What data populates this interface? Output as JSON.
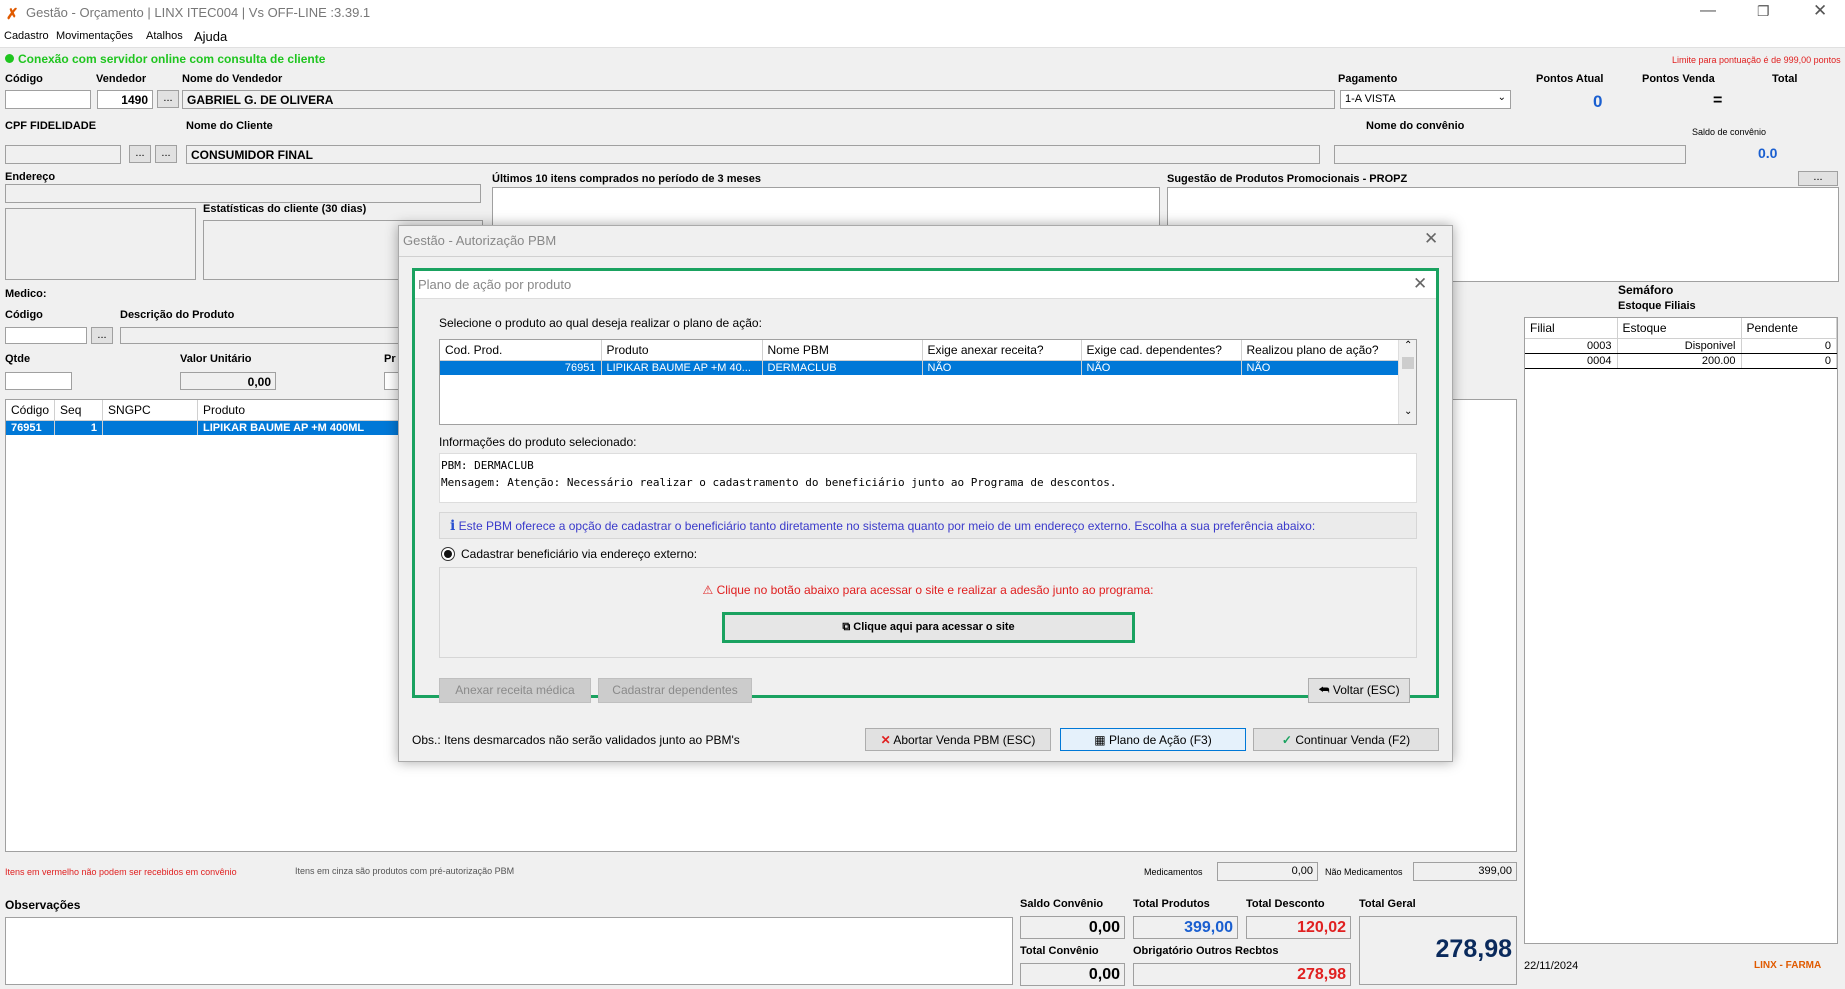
{
  "window": {
    "title": "Gestão - Orçamento  | LINX ITEC004 | Vs OFF-LINE :3.39.1",
    "menu": [
      "Cadastro",
      "Movimentações",
      "Atalhos",
      "Ajuda"
    ]
  },
  "status": {
    "connection": "Conexão com servidor online com consulta de cliente",
    "limit_note": "Limite para pontuação é de 999,00 pontos"
  },
  "header": {
    "codigo_label": "Código",
    "vendedor_label": "Vendedor",
    "vendedor_value": "1490",
    "nome_vendedor_label": "Nome do Vendedor",
    "nome_vendedor_value": "GABRIEL G. DE OLIVERA",
    "pagamento_label": "Pagamento",
    "pagamento_value": "1-A VISTA",
    "pontos_atual_label": "Pontos Atual",
    "pontos_atual_value": "0",
    "pontos_venda_label": "Pontos Venda",
    "pontos_venda_value": "=",
    "total_label": "Total",
    "cpf_label": "CPF FIDELIDADE",
    "nome_cliente_label": "Nome do Cliente",
    "nome_cliente_value": "CONSUMIDOR FINAL",
    "nome_convenio_label": "Nome do convênio",
    "saldo_convenio_label": "Saldo de convênio",
    "saldo_convenio_value": "0.0",
    "endereco_label": "Endereço",
    "ultimos_label": "Últimos 10 itens comprados no período de 3 meses",
    "sugestao_label": "Sugestão de Produtos Promocionais - PROPZ",
    "estatisticas_label": "Estatísticas do cliente  (30 dias)",
    "medico_label": "Medico:",
    "codigo2_label": "Código",
    "descricao_label": "Descrição do Produto",
    "qtde_label": "Qtde",
    "valor_unit_label": "Valor Unitário",
    "valor_unit_value": "0,00",
    "pr_label": "Pr",
    "ellipsis": "..."
  },
  "items_table": {
    "columns": [
      "Código",
      "Seq",
      "SNGPC",
      "Produto"
    ],
    "rows": [
      [
        "76951",
        "1",
        "",
        "LIPIKAR BAUME AP +M 400ML"
      ]
    ]
  },
  "semaforo": {
    "title": "Semáforo",
    "subtitle": "Estoque Filiais",
    "columns": [
      "Filial",
      "Estoque",
      "Pendente"
    ],
    "rows": [
      [
        "0003",
        "Disponivel",
        "0"
      ],
      [
        "0004",
        "200.00",
        "0"
      ]
    ]
  },
  "notes": {
    "red_note": "Itens em vermelho não podem ser recebidos em convênio",
    "gray_note": "Itens em cinza são produtos com pré-autorização PBM",
    "medicamentos_label": "Medicamentos",
    "medicamentos_value": "0,00",
    "nao_medicamentos_label": "Não Medicamentos",
    "nao_medicamentos_value": "399,00"
  },
  "footer": {
    "observacoes_label": "Observações",
    "saldo_convenio_label": "Saldo Convênio",
    "saldo_convenio_value": "0,00",
    "total_produtos_label": "Total Produtos",
    "total_produtos_value": "399,00",
    "total_desconto_label": "Total Desconto",
    "total_desconto_value": "120,02",
    "total_geral_label": "Total Geral",
    "total_geral_value": "278,98",
    "total_convenio_label": "Total Convênio",
    "total_convenio_value": "0,00",
    "obrigatorio_label": "Obrigatório Outros Recbtos",
    "obrigatorio_value": "278,98",
    "date": "22/11/2024",
    "brand": "LINX - FARMA"
  },
  "pbm_dialog": {
    "title": "Gestão - Autorização PBM",
    "obs": "Obs.: Itens desmarcados não serão validados junto ao PBM's",
    "abortar": "Abortar Venda PBM (ESC)",
    "plano": "Plano de Ação (F3)",
    "continuar": "Continuar Venda (F2)"
  },
  "plano_dialog": {
    "title": "Plano de ação por produto",
    "instruction": "Selecione o produto ao qual deseja realizar o plano de ação:",
    "columns": [
      "Cod. Prod.",
      "Produto",
      "Nome PBM",
      "Exige anexar receita?",
      "Exige cad. dependentes?",
      "Realizou plano de ação?"
    ],
    "rows": [
      [
        "76951",
        "LIPIKAR BAUME AP +M 40...",
        "DERMACLUB",
        "NÃO",
        "NÃO",
        "NÃO"
      ]
    ],
    "info_label": "Informações do produto selecionado:",
    "info_line1": "PBM: DERMACLUB",
    "info_line2": "Mensagem: Atenção: Necessário realizar o cadastramento do beneficiário junto ao Programa de descontos.",
    "notice": "Este PBM oferece a opção de cadastrar o beneficiário tanto diretamente no sistema quanto por meio de um endereço externo. Escolha a sua preferência abaixo:",
    "radio_label": "Cadastrar beneficiário via endereço externo:",
    "warning": "Clique no botão abaixo para acessar o site e realizar a adesão junto ao programa:",
    "site_button": "Clique aqui para acessar o site",
    "anexar": "Anexar receita médica",
    "cadastrar": "Cadastrar dependentes",
    "voltar": "Voltar (ESC)"
  },
  "colors": {
    "accent": "#0078d7",
    "green": "#1aa260",
    "red": "#e02020",
    "blue_value": "#1a5fd0"
  }
}
